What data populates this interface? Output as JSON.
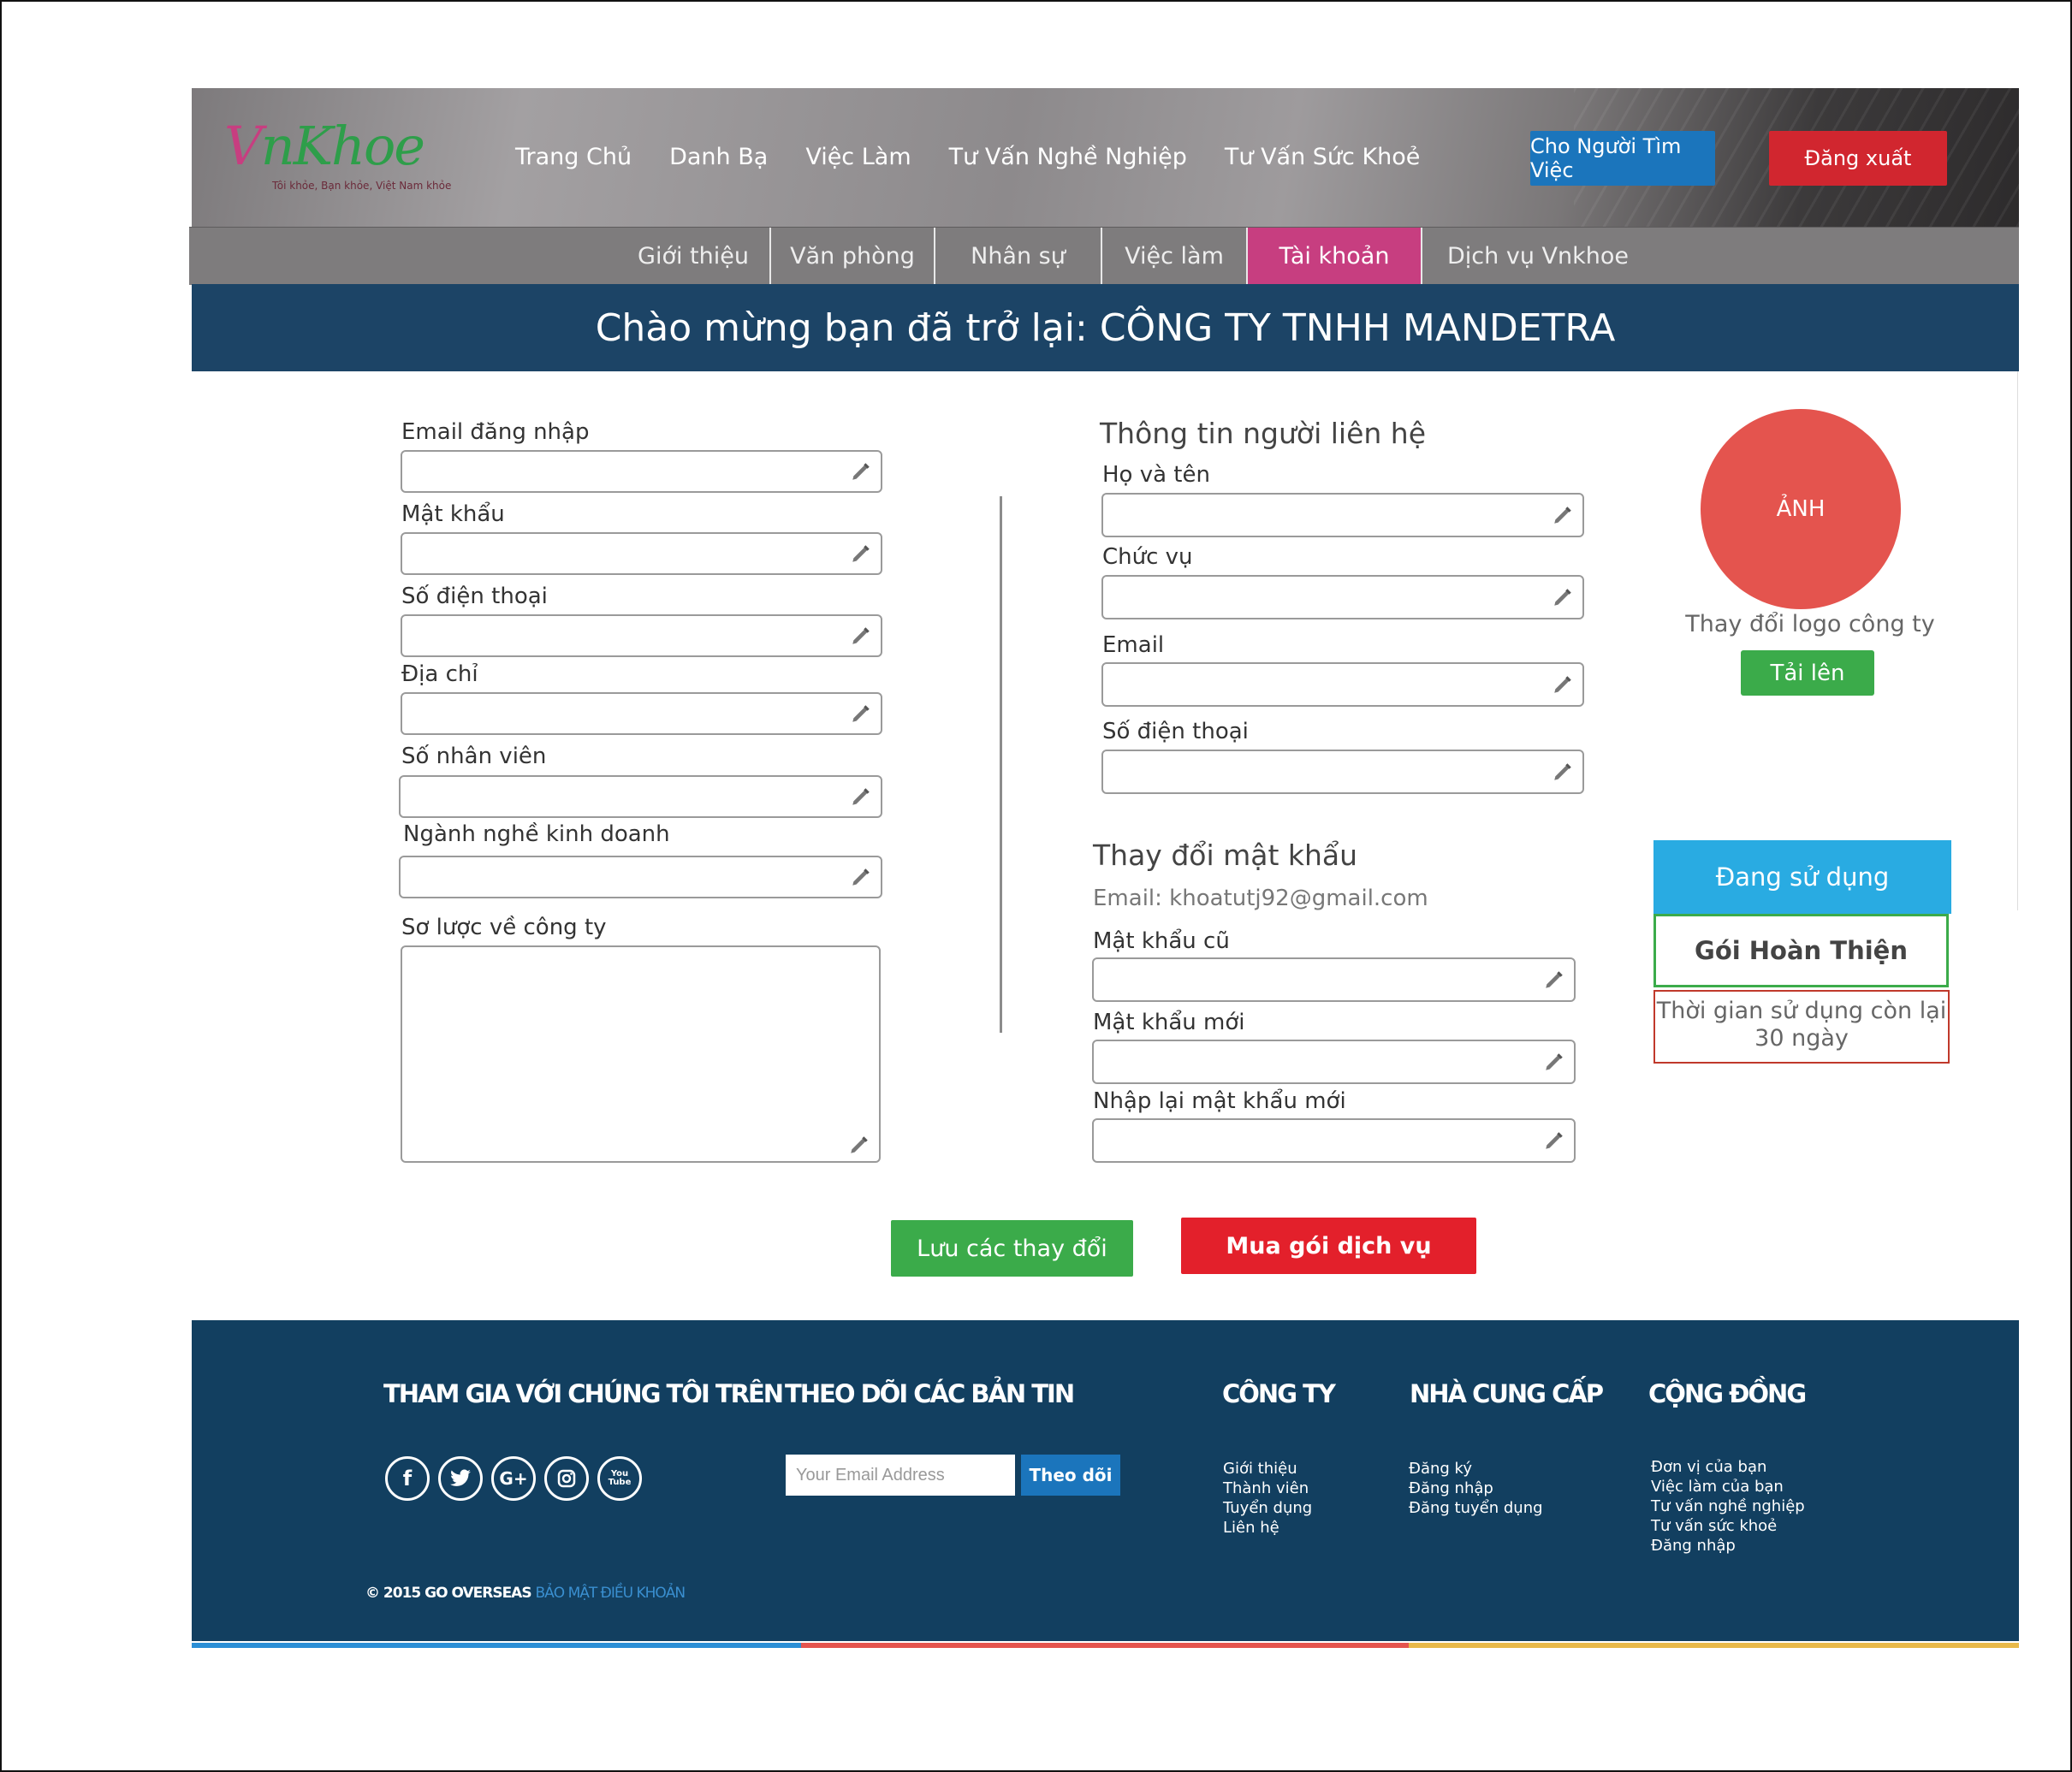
{
  "logo": {
    "text_prefix": "V",
    "text_main": "nKhoe",
    "tagline": "Tôi khỏe, Bạn khỏe, Việt Nam khỏe"
  },
  "nav": {
    "items": [
      "Trang Chủ",
      "Danh Bạ",
      "Việc Làm",
      "Tư Vấn Nghề Nghiệp",
      "Tư Vấn Sức Khoẻ"
    ]
  },
  "header": {
    "seeker_button": "Cho Người Tìm Việc",
    "logout_button": "Đăng xuất"
  },
  "subnav": {
    "tabs": [
      "Giới thiệu",
      "Văn phòng",
      "Nhân sự",
      "Việc làm",
      "Tài khoản",
      "Dịch vụ Vnkhoe"
    ],
    "active": "Tài khoản"
  },
  "banner": {
    "text": "Chào mừng bạn đã trở lại: CÔNG TY TNHH MANDETRA"
  },
  "account_form": {
    "email_label": "Email đăng nhập",
    "password_label": "Mật khẩu",
    "phone_label": "Số điện thoại",
    "address_label": "Địa chỉ",
    "employees_label": "Số nhân viên",
    "business_label": "Ngành nghề kinh doanh",
    "summary_label": "Sơ lược về công ty"
  },
  "contact_form": {
    "heading": "Thông tin người liên hệ",
    "name_label": "Họ và tên",
    "position_label": "Chức vụ",
    "email_label": "Email",
    "phone_label": "Số điện thoại"
  },
  "password_form": {
    "heading": "Thay đổi mật khẩu",
    "email_note": "Email: khoatutj92@gmail.com",
    "old_label": "Mật khẩu cũ",
    "new_label": "Mật khẩu mới",
    "confirm_label": "Nhập lại mật khẩu mới"
  },
  "logo_upload": {
    "avatar_text": "ẢNH",
    "change_text": "Thay đổi logo công ty",
    "upload_button": "Tải lên"
  },
  "package": {
    "status": "Đang sử dụng",
    "name": "Gói Hoàn Thiện",
    "remaining_line1": "Thời gian sử dụng còn lại",
    "remaining_line2": "30 ngày"
  },
  "actions": {
    "save_button": "Lưu các thay đổi",
    "buy_button": "Mua gói dịch vụ"
  },
  "footer": {
    "join_heading": "THAM GIA VỚI CHÚNG TÔI TRÊN",
    "newsletter_heading": "THEO DÕI CÁC BẢN TIN",
    "newsletter_placeholder": "Your Email Address",
    "newsletter_button": "Theo dõi",
    "social": {
      "facebook": "f",
      "twitter": "t",
      "gplus": "G+",
      "instagram": "ig",
      "youtube": "You Tube"
    },
    "company_heading": "CÔNG TY",
    "company_links": [
      "Giới thiệu",
      "Thành viên",
      "Tuyển dụng",
      "Liên hệ"
    ],
    "provider_heading": "NHÀ CUNG CẤP",
    "provider_links": [
      "Đăng ký",
      "Đăng nhập",
      "Đăng tuyển dụng"
    ],
    "community_heading": "CỘNG ĐỒNG",
    "community_links": [
      "Đơn vị của bạn",
      "Việc làm của bạn",
      "Tư vấn nghề nghiệp",
      "Tư vấn sức khoẻ",
      "Đăng nhập"
    ],
    "copyright": "© 2015 GO OVERSEAS",
    "copyright_links": "BẢO MẬT ĐIỀU KHOẢN"
  },
  "colors": {
    "header_blue": "#1c4466",
    "active_tab": "#c73e80",
    "green": "#3bab4a",
    "red": "#e3202b",
    "footer": "#123f60"
  }
}
